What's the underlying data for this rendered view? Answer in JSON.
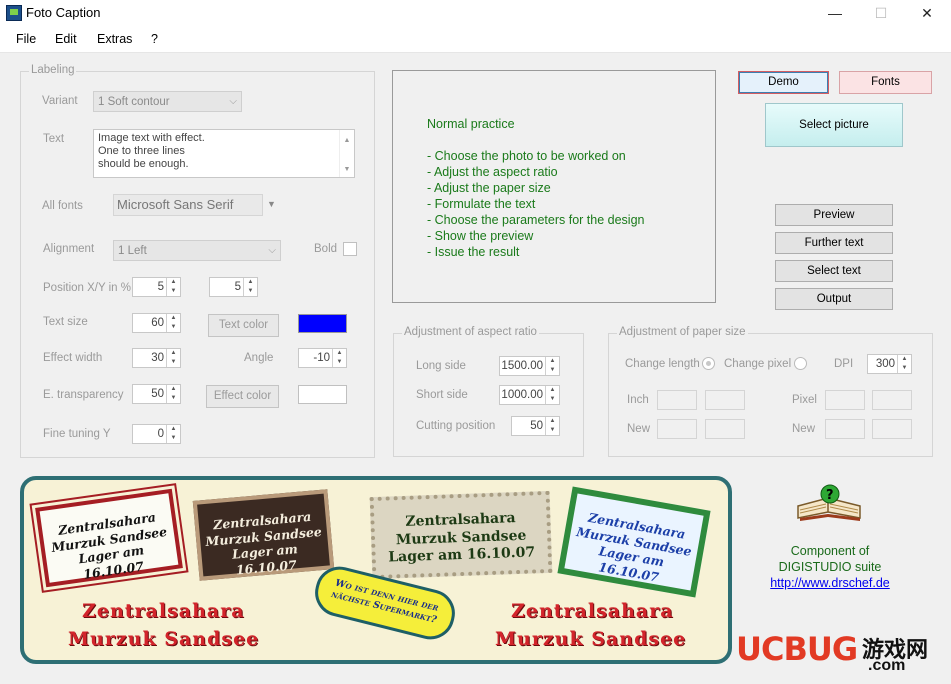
{
  "window": {
    "title": "Foto Caption",
    "minimize": "—",
    "maximize": "☐",
    "close": "✕"
  },
  "menu": [
    "File",
    "Edit",
    "Extras",
    "?"
  ],
  "labeling": {
    "title": "Labeling",
    "variant_label": "Variant",
    "variant_value": "1 Soft contour",
    "text_label": "Text",
    "text_lines": [
      "Image text with effect.",
      "One to three lines",
      "should be enough."
    ],
    "fonts_label": "All fonts",
    "font_value": "Microsoft Sans Serif",
    "alignment_label": "Alignment",
    "alignment_value": "1 Left",
    "bold_label": "Bold",
    "position_label": "Position X/Y in %",
    "pos_x": "5",
    "pos_y": "5",
    "text_size_label": "Text size",
    "text_size": "60",
    "text_color_button": "Text color",
    "text_color": "#0000ff",
    "effect_width_label": "Effect width",
    "effect_width": "30",
    "angle_label": "Angle",
    "angle": "-10",
    "transparency_label": "E. transparency",
    "transparency": "50",
    "effect_color_button": "Effect color",
    "effect_color": "#ffffff",
    "fine_tuning_label": "Fine tuning Y",
    "fine_tuning": "0"
  },
  "info": {
    "heading": "Normal practice",
    "steps": [
      "- Choose the photo to be worked on",
      "- Adjust the aspect ratio",
      "- Adjust the paper size",
      "- Formulate the text",
      "- Choose the parameters for the design",
      "- Show the preview",
      "- Issue the result"
    ]
  },
  "buttons": {
    "demo": "Demo",
    "fonts": "Fonts",
    "select_picture": "Select picture",
    "preview": "Preview",
    "further_text": "Further text",
    "select_text": "Select text",
    "output": "Output"
  },
  "aspect": {
    "title": "Adjustment of aspect ratio",
    "long_label": "Long side",
    "long_value": "1500.00",
    "short_label": "Short side",
    "short_value": "1000.00",
    "cut_label": "Cutting position",
    "cut_value": "50"
  },
  "paper": {
    "title": "Adjustment of paper size",
    "change_length": "Change length",
    "change_pixel": "Change pixel",
    "dpi_label": "DPI",
    "dpi_value": "300",
    "inch_label": "Inch",
    "pixel_label": "Pixel",
    "new_label": "New",
    "new_label2": "New"
  },
  "banner": {
    "stamp1": [
      "Zentralsahara",
      "Murzuk Sandsee",
      "Lager am 16.10.07"
    ],
    "stamp2": [
      "Zentralsahara",
      "Murzuk Sandsee",
      "Lager am 16.10.07"
    ],
    "stamp3": [
      "Zentralsahara",
      "Murzuk Sandsee",
      "Lager am 16.10.07"
    ],
    "stamp4": [
      "Zentralsahara",
      "Murzuk Sandsee",
      "Lager am 16.10.07"
    ],
    "bubble": [
      "Wo ist denn hier der",
      "nächste Supermarkt?"
    ],
    "red_left": [
      "Zentralsahara",
      "Murzuk Sandsee"
    ],
    "red_right": [
      "Zentralsahara",
      "Murzuk Sandsee"
    ]
  },
  "component": {
    "line1": "Component of",
    "line2": "DIGISTUDIO suite",
    "url": "http://www.drschef.de"
  },
  "watermark": {
    "brand": "UCBUG",
    "cn": "游戏网",
    "domain": ".com"
  }
}
